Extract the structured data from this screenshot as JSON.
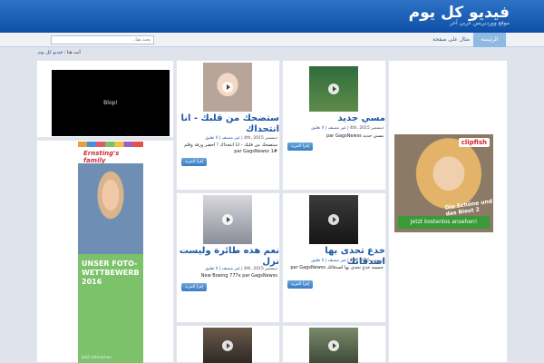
{
  "header": {
    "site_title": "فيديو كل يوم",
    "site_description": "موقع ووردبريس عربي آخر"
  },
  "nav": {
    "home": "الرئيسة",
    "about": "مثال على صفحة"
  },
  "search": {
    "placeholder": "بحث هنا.."
  },
  "breadcrumb": {
    "prefix": "أنت هنا :",
    "home": "فيديو كل يوم"
  },
  "sidebar": {
    "video_label": "Blop!",
    "ad_left": {
      "brand": "Ernsting's family",
      "text": "UNSER FOTO-WETTBEWERB 2016",
      "footer": "Jetzt mitmachen"
    }
  },
  "ad_right": {
    "brand": "clipfish",
    "title": "Die Schöne und das Biest 2",
    "cta": "Jetzt kostenlos ansehen!"
  },
  "posts": [
    {
      "title": "مسي جديد",
      "date": "ديسمبر 4th, 2015",
      "category": "غير مصنف",
      "comments": "لا تعليق",
      "excerpt": "مسي جديد par GagsNewss",
      "read_more": "إقرأ المزيد"
    },
    {
      "title": "ستضحك من قلبك - انا انتحداك",
      "date": "ديسمبر 4th, 2015",
      "category": "غير مصنف",
      "comments": "لا تعليق",
      "excerpt": "ستضحك من قلبك - انا انتحداك ! احضر ورقة وقلم #1 par GagsNewss",
      "read_more": "إقرأ المزيد"
    },
    {
      "title": "خدع تحدى بها اصدقائك",
      "date": "ديسمبر 4th, 2015",
      "category": "غير مصنف",
      "comments": "لا تعليق",
      "excerpt": "خمسة خدع تحدى بها اصدقائك par GagsNewss",
      "read_more": "إقرأ المزيد"
    },
    {
      "title": "نعم هذه طائرة وليست نزل",
      "date": "ديسمبر 4th, 2015",
      "category": "غير مصنف",
      "comments": "لا تعليق",
      "excerpt": "New Boeing 777x par GagsNewss",
      "read_more": "إقرأ المزيد"
    }
  ]
}
